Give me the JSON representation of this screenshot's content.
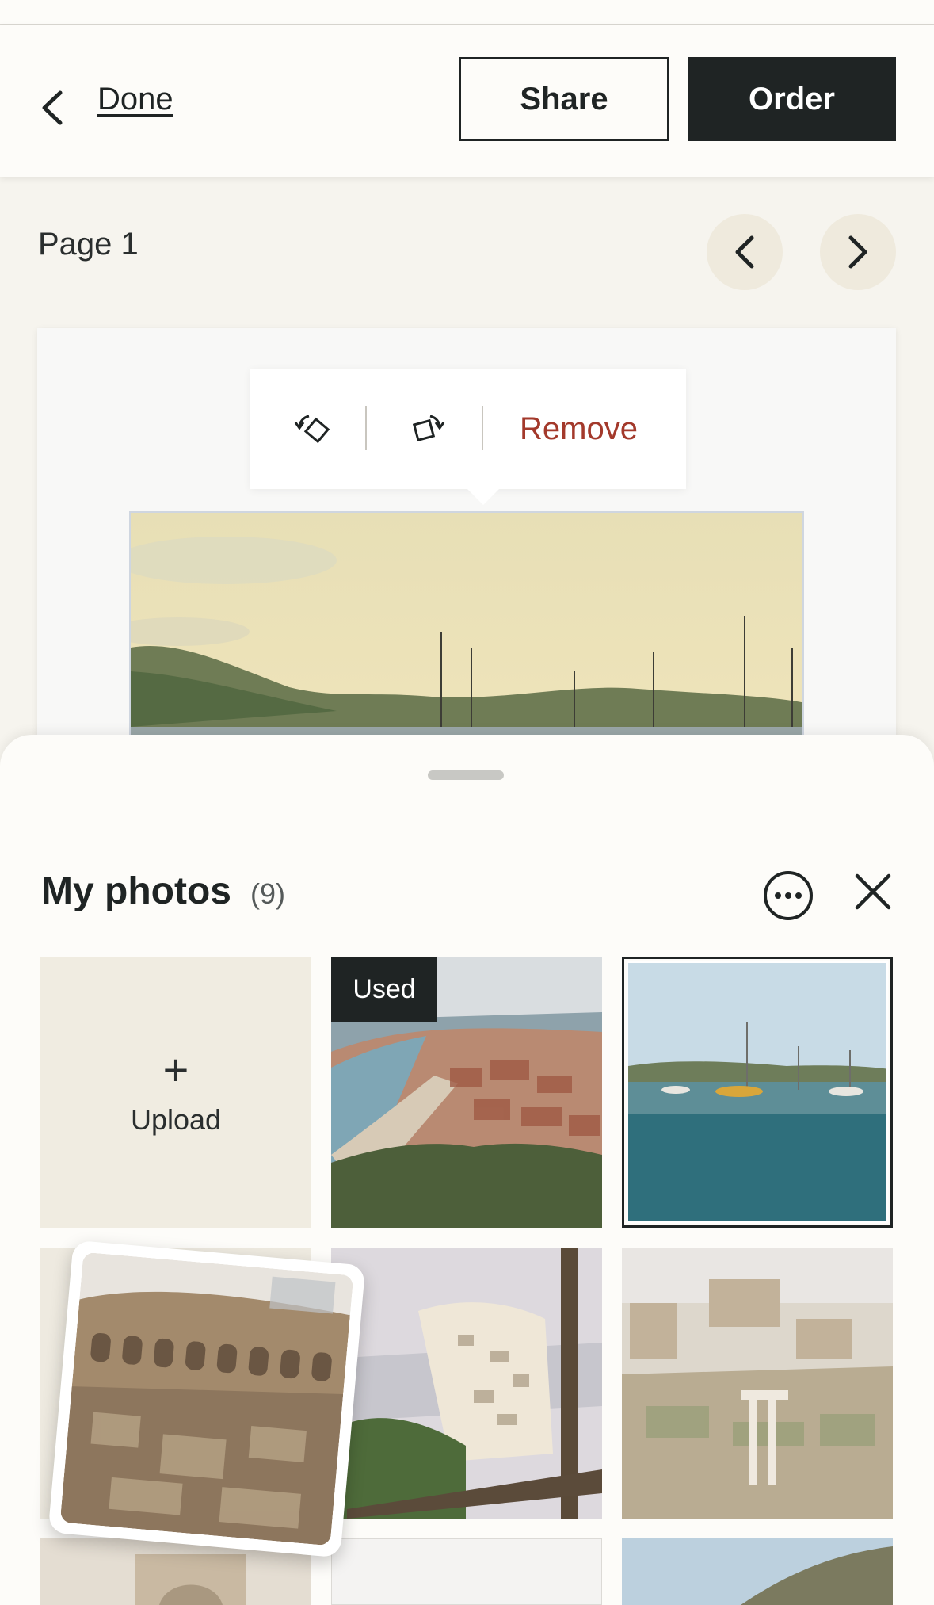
{
  "header": {
    "done_label": "Done",
    "share_label": "Share",
    "order_label": "Order"
  },
  "editor": {
    "page_label": "Page 1",
    "toolbar": {
      "rotate_left_icon": "rotate-left-icon",
      "rotate_right_icon": "rotate-right-icon",
      "remove_label": "Remove"
    }
  },
  "photos_panel": {
    "title": "My photos",
    "count": "(9)",
    "upload_label": "Upload",
    "upload_plus": "+",
    "used_badge": "Used",
    "photos": [
      {
        "subject": "coastal town beach",
        "used": true,
        "selected": false
      },
      {
        "subject": "harbor sailboats",
        "used": false,
        "selected": true
      },
      {
        "subject": "colosseum",
        "used": false,
        "selected": false,
        "dragging": true
      },
      {
        "subject": "cliffside village",
        "used": false,
        "selected": false
      },
      {
        "subject": "roman forum",
        "used": false,
        "selected": false
      },
      {
        "subject": "cathedral facade",
        "used": false,
        "selected": false
      },
      {
        "subject": "blank",
        "used": false,
        "selected": false
      },
      {
        "subject": "rocky coast",
        "used": false,
        "selected": false
      }
    ]
  },
  "colors": {
    "ink": "#1f2424",
    "accent_remove": "#a3392b",
    "canvas": "#f6f4ee",
    "upload_tile": "#f0ece1"
  }
}
